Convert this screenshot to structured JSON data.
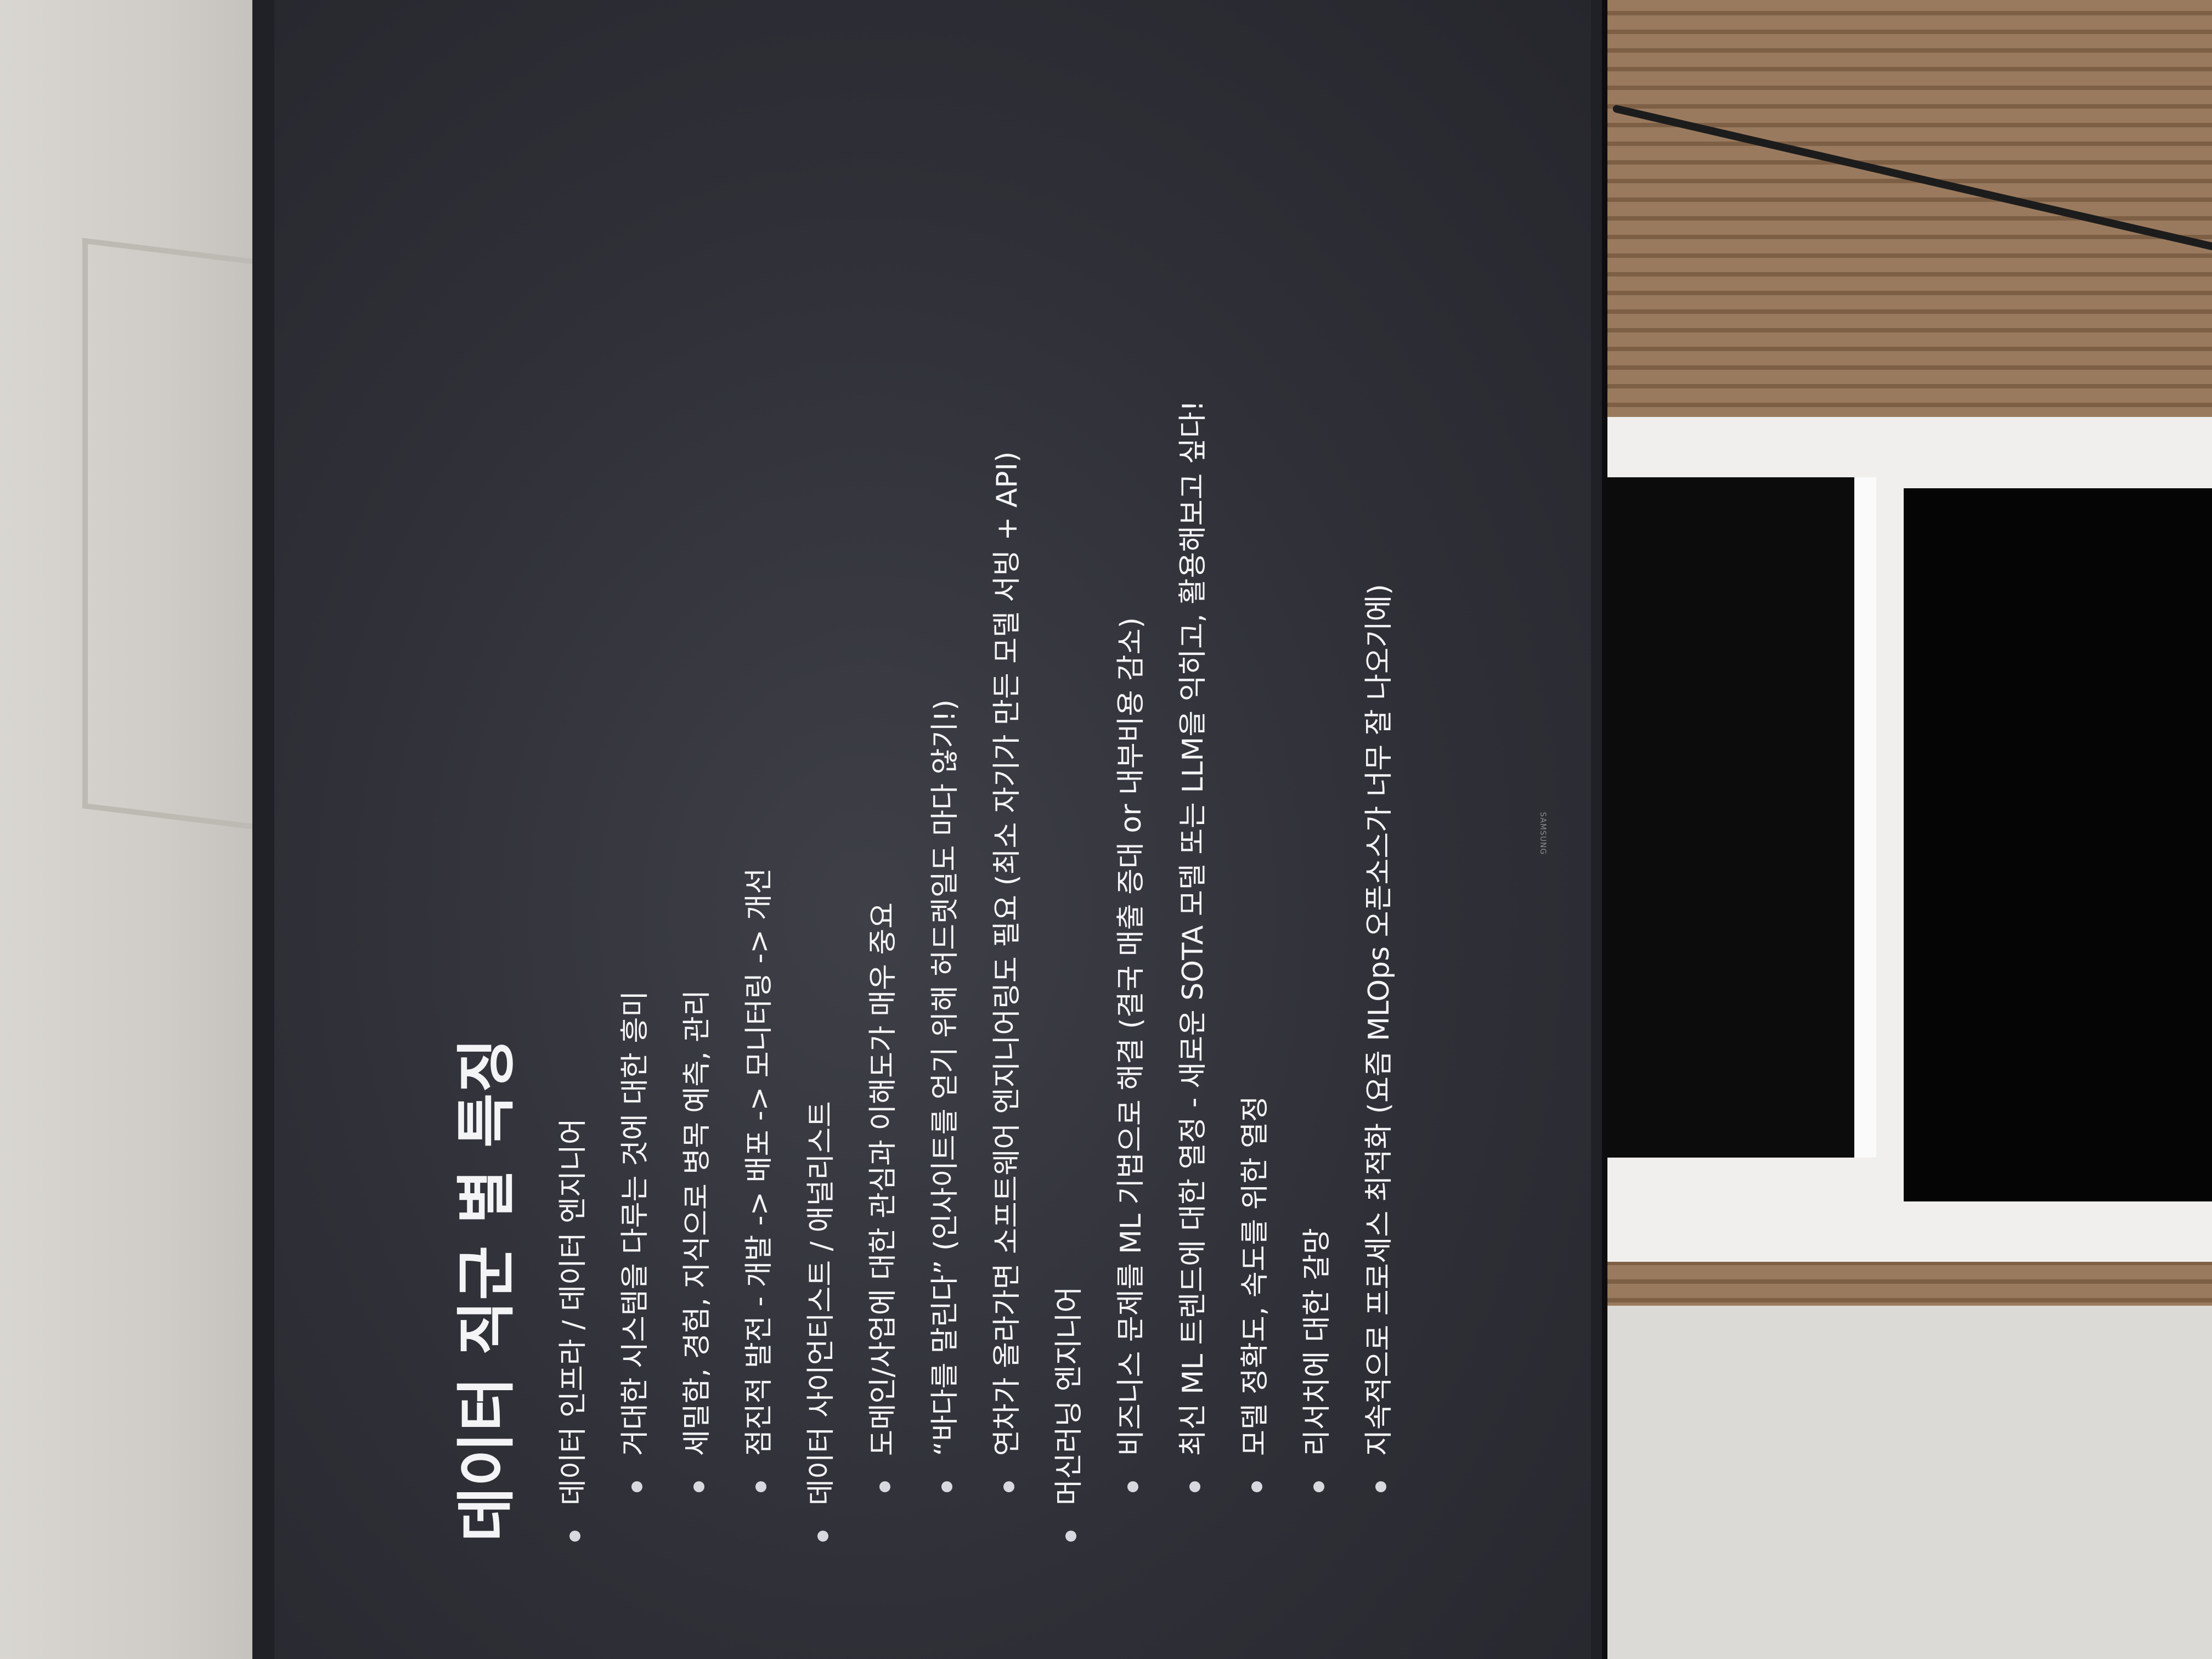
{
  "slide": {
    "title": "데이터 직군 별 특징",
    "lines": [
      {
        "level": 0,
        "text": "데이터 인프라 / 데이터 엔지니어"
      },
      {
        "level": 1,
        "text": "거대한 시스템을 다루는 것에 대한 흥미"
      },
      {
        "level": 1,
        "text": "세밀함, 경험, 지식으로 병목 예측, 관리"
      },
      {
        "level": 1,
        "text": "점진적 발전 - 개발 -> 배포 -> 모니터링 -> 개선"
      },
      {
        "level": 0,
        "text": "데이터 사이언티스트 / 애널리스트"
      },
      {
        "level": 1,
        "text": "도메인/사업에 대한 관심과 이해도가 매우 중요"
      },
      {
        "level": 1,
        "text": "“바다를 말린다” (인사이트를 얻기 위해 허드렛일도 마다 않기!)"
      },
      {
        "level": 1,
        "text": "연차가 올라가면 소프트웨어 엔지니어링도 필요 (최소 자기가 만든 모델 서빙 + API)"
      },
      {
        "level": 0,
        "text": "머신러닝 엔지니어"
      },
      {
        "level": 1,
        "text": "비즈니스 문제를 ML 기법으로 해결 (결국 매출 증대 or 내부비용 감소)"
      },
      {
        "level": 1,
        "text": "최신 ML 트렌드에 대한 열정 - 새로운 SOTA 모델 또는 LLM을 익히고, 활용해보고 싶다!"
      },
      {
        "level": 1,
        "text": "모델 정확도, 속도를 위한 열정"
      },
      {
        "level": 1,
        "text": "리서치에 대한 갈망"
      },
      {
        "level": 1,
        "text": "지속적으로 프로세스 최적화 (요즘 MLOps 오픈소스가 너무 잘 나오기에)"
      }
    ]
  },
  "tv": {
    "brand": "SAMSUNG"
  }
}
